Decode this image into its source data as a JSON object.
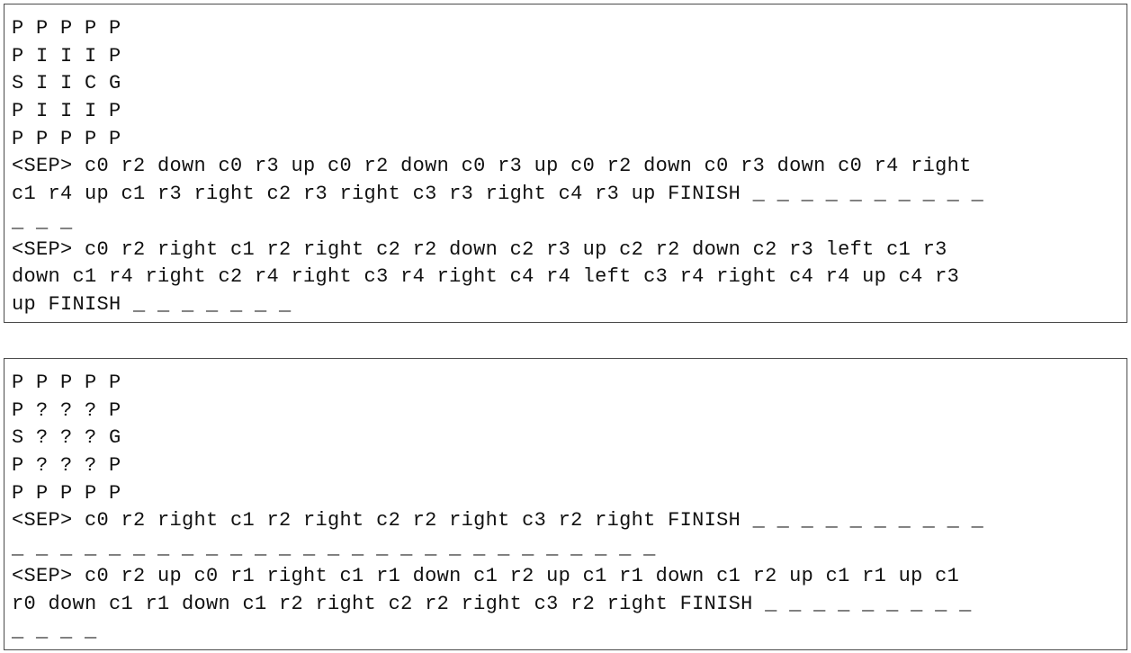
{
  "panels": [
    {
      "lines": [
        "P P P P P",
        "P I I I P",
        "S I I C G",
        "P I I I P",
        "P P P P P",
        "<SEP> c0 r2 down c0 r3 up c0 r2 down c0 r3 up c0 r2 down c0 r3 down c0 r4 right",
        "c1 r4 up c1 r3 right c2 r3 right c3 r3 right c4 r3 up FINISH _ _ _ _ _ _ _ _ _ _",
        "_ _ _",
        "<SEP> c0 r2 right c1 r2 right c2 r2 down c2 r3 up c2 r2 down c2 r3 left c1 r3",
        "down c1 r4 right c2 r4 right c3 r4 right c4 r4 left c3 r4 right c4 r4 up c4 r3",
        "up FINISH _ _ _ _ _ _ _"
      ]
    },
    {
      "lines": [
        "P P P P P",
        "P ? ? ? P",
        "S ? ? ? G",
        "P ? ? ? P",
        "P P P P P",
        "<SEP> c0 r2 right c1 r2 right c2 r2 right c3 r2 right FINISH _ _ _ _ _ _ _ _ _ _",
        "_ _ _ _ _ _ _ _ _ _ _ _ _ _ _ _ _ _ _ _ _ _ _ _ _ _ _",
        "<SEP> c0 r2 up c0 r1 right c1 r1 down c1 r2 up c1 r1 down c1 r2 up c1 r1 up c1",
        "r0 down c1 r1 down c1 r2 right c2 r2 right c3 r2 right FINISH _ _ _ _ _ _ _ _ _",
        "_ _ _ _"
      ]
    }
  ]
}
